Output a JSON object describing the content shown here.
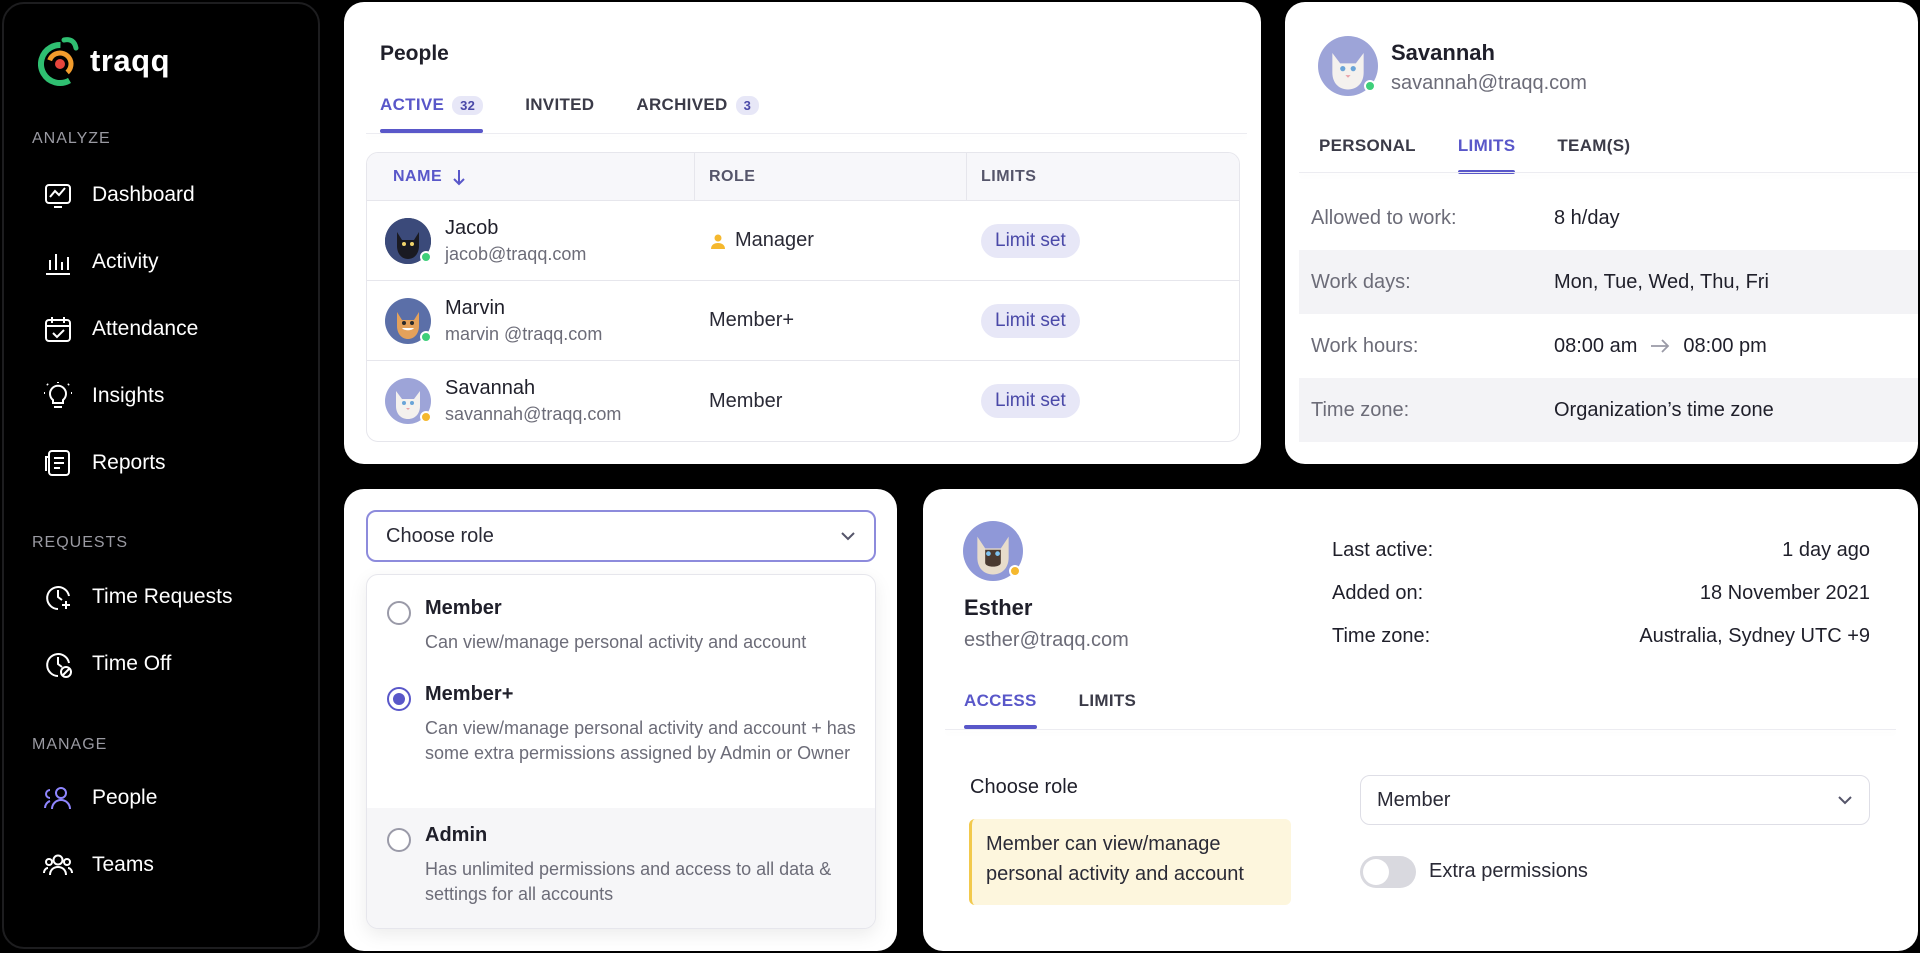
{
  "app": {
    "name": "traqq"
  },
  "sidebar": {
    "sections": [
      {
        "label": "ANALYZE",
        "items": [
          "Dashboard",
          "Activity",
          "Attendance",
          "Insights",
          "Reports"
        ]
      },
      {
        "label": "REQUESTS",
        "items": [
          "Time Requests",
          "Time Off"
        ]
      },
      {
        "label": "MANAGE",
        "items": [
          "People",
          "Teams"
        ]
      }
    ],
    "active_item": "People"
  },
  "people": {
    "title": "People",
    "tabs": [
      {
        "label": "ACTIVE",
        "count": "32",
        "active": true
      },
      {
        "label": "INVITED",
        "count": "",
        "active": false
      },
      {
        "label": "ARCHIVED",
        "count": "3",
        "active": false
      }
    ],
    "columns": [
      "NAME",
      "ROLE",
      "LIMITS"
    ],
    "rows": [
      {
        "name": "Jacob",
        "email": "jacob@traqq.com",
        "role": "Manager",
        "limits": "Limit set",
        "status": "online"
      },
      {
        "name": "Marvin",
        "email": "marvin @traqq.com",
        "role": "Member+",
        "limits": "Limit set",
        "status": "online"
      },
      {
        "name": "Savannah",
        "email": "savannah@traqq.com",
        "role": "Member",
        "limits": "Limit set",
        "status": "away"
      }
    ]
  },
  "profile_limits": {
    "name": "Savannah",
    "email": "savannah@traqq.com",
    "tabs": [
      "PERSONAL",
      "LIMITS",
      "TEAM(S)"
    ],
    "active_tab": "LIMITS",
    "rows": [
      {
        "label": "Allowed to work:",
        "value": "8 h/day"
      },
      {
        "label": "Work days:",
        "value": "Mon, Tue, Wed, Thu, Fri"
      },
      {
        "label": "Work hours:",
        "from": "08:00 am",
        "to": "08:00 pm"
      },
      {
        "label": "Time zone:",
        "value": "Organization’s time zone"
      }
    ]
  },
  "role_picker": {
    "placeholder": "Choose role",
    "options": [
      {
        "title": "Member",
        "desc": "Can view/manage personal activity and account",
        "selected": false
      },
      {
        "title": "Member+",
        "desc": "Can view/manage personal activity and account + has some extra permissions assigned by Admin or Owner",
        "selected": true
      },
      {
        "title": "Admin",
        "desc": "Has unlimited permissions and access to all data & settings for all accounts",
        "selected": false
      }
    ]
  },
  "esther": {
    "name": "Esther",
    "email": "esther@traqq.com",
    "meta": [
      {
        "label": "Last active:",
        "value": "1 day ago"
      },
      {
        "label": "Added on:",
        "value": "18 November 2021"
      },
      {
        "label": "Time zone:",
        "value": "Australia, Sydney UTC +9"
      }
    ],
    "tabs": [
      "ACCESS",
      "LIMITS"
    ],
    "active_tab": "ACCESS",
    "choose_role_label": "Choose role",
    "role_value": "Member",
    "note": "Member can view/manage personal activity and account",
    "toggle_label": "Extra permissions",
    "toggle_on": false
  },
  "colors": {
    "accent": "#5957c9",
    "online": "#3ecf7a",
    "away": "#f5b82e",
    "pill_bg": "#e7e7f7"
  }
}
